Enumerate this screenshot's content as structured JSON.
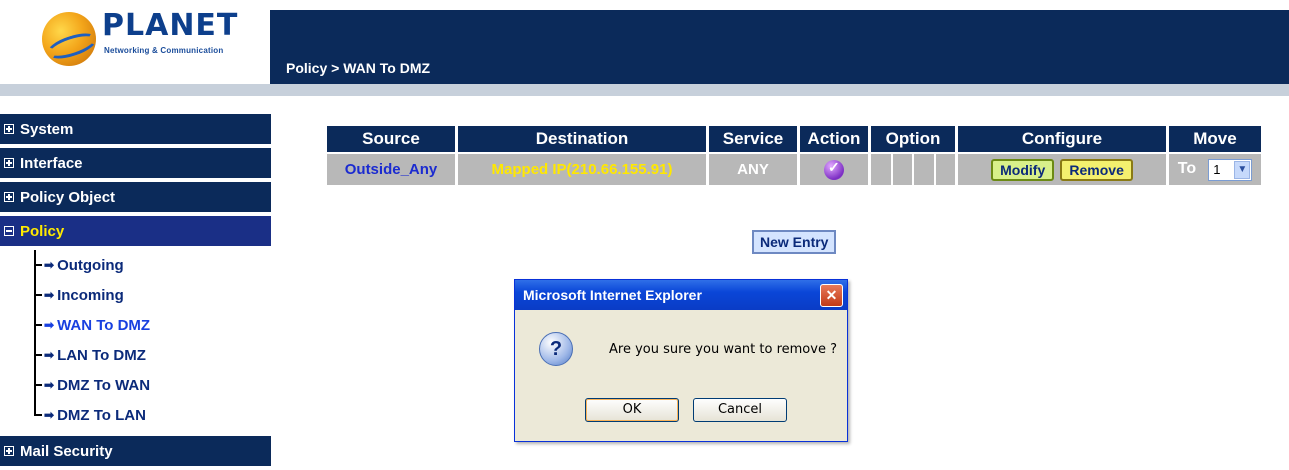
{
  "logo": {
    "word": "PLANET",
    "sub": "Networking & Communication"
  },
  "breadcrumb": "Policy > WAN To DMZ",
  "sidebar": {
    "items": [
      {
        "label": "System",
        "expanded": false
      },
      {
        "label": "Interface",
        "expanded": false
      },
      {
        "label": "Policy Object",
        "expanded": false
      },
      {
        "label": "Policy",
        "expanded": true
      }
    ],
    "subitems": [
      "Outgoing",
      "Incoming",
      "WAN To DMZ",
      "LAN To DMZ",
      "DMZ To WAN",
      "DMZ To LAN"
    ],
    "after": {
      "label": "Mail Security"
    }
  },
  "table": {
    "headers": [
      "Source",
      "Destination",
      "Service",
      "Action",
      "Option",
      "Configure",
      "Move"
    ],
    "row": {
      "source": "Outside_Any",
      "destination": "Mapped IP(210.66.155.91)",
      "service": "ANY",
      "action_icon": "permit-check-icon",
      "modify": "Modify",
      "remove": "Remove",
      "to": "To",
      "move_value": "1"
    }
  },
  "new_entry": "New Entry",
  "dialog": {
    "title": "Microsoft Internet Explorer",
    "message": "Are you sure you want to remove ?",
    "ok": "OK",
    "cancel": "Cancel"
  },
  "colors": {
    "nav_bg": "#0b2a5a",
    "source_text": "#1b2bd0",
    "destination_text": "#ffe800"
  }
}
